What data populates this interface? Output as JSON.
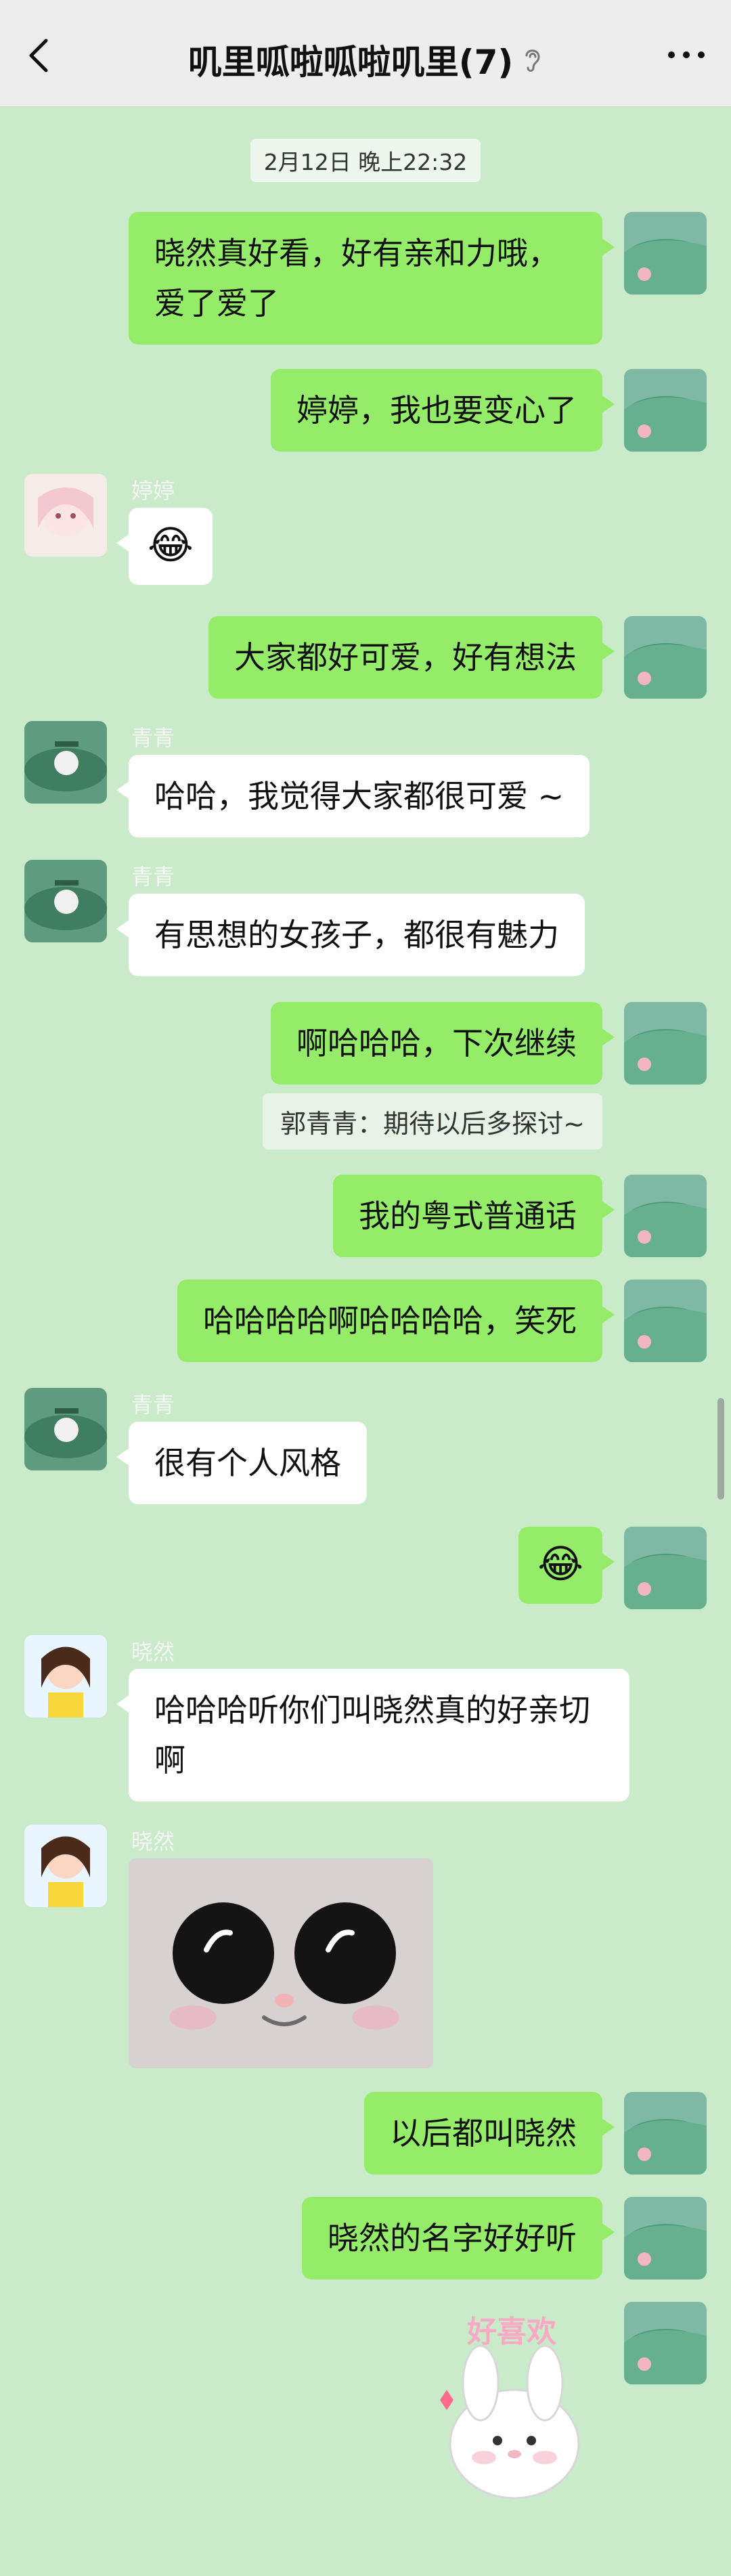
{
  "header": {
    "title": "叽里呱啦呱啦叽里(7)",
    "icons": [
      "back-icon",
      "ear-icon",
      "more-icon"
    ]
  },
  "timestamp": "2月12日 晚上22:32",
  "messages": [
    {
      "side": "right",
      "text": "晓然真好看，好有亲和力哦，爱了爱了"
    },
    {
      "side": "right",
      "text": "婷婷，我也要变心了"
    },
    {
      "side": "left",
      "sender": "婷婷",
      "emoji": "😭😂"
    },
    {
      "side": "right",
      "text": "大家都好可爱，好有想法"
    },
    {
      "side": "left",
      "sender": "青青",
      "text": "哈哈，我觉得大家都很可爱 ~"
    },
    {
      "side": "left",
      "sender": "青青",
      "text": "有思想的女孩子，都很有魅力"
    },
    {
      "side": "right",
      "text": "啊哈哈哈，下次继续"
    },
    {
      "quote": "郭青青：期待以后多探讨~"
    },
    {
      "side": "right",
      "text": "我的粤式普通话"
    },
    {
      "side": "right",
      "text": "哈哈哈哈啊哈哈哈哈，笑死"
    },
    {
      "side": "left",
      "sender": "青青",
      "text": "很有个人风格"
    },
    {
      "side": "right",
      "emoji": "😂"
    },
    {
      "side": "left",
      "sender": "晓然",
      "text": "哈哈哈听你们叫晓然真的好亲切啊"
    },
    {
      "side": "left",
      "sender": "晓然",
      "image": "cat-sticker"
    },
    {
      "side": "right",
      "text": "以后都叫晓然"
    },
    {
      "side": "right",
      "text": "晓然的名字好好听"
    },
    {
      "side": "right",
      "sticker_text": "好喜欢"
    }
  ],
  "colors": {
    "background": "#c9ebc9",
    "green_bubble": "#95ec69",
    "white_bubble": "#ffffff",
    "header": "#ededed"
  }
}
